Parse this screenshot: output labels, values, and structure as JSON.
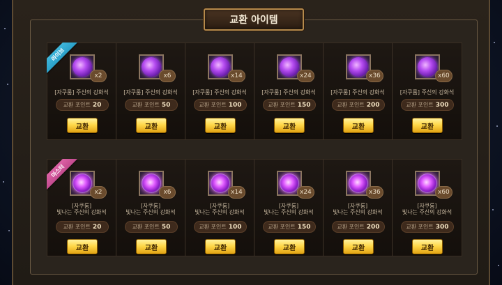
{
  "title": "교환 아이템",
  "colors": {
    "ribbon_live": "#2aa0c8",
    "ribbon_master": "#c24a8e",
    "button_gold": "#ffd84a"
  },
  "groups": [
    {
      "ribbon": "라이브",
      "items": [
        {
          "icon": "purple-gem-icon",
          "qty": "x2",
          "name_line1": "[자쿠룸] 주신의 강화석",
          "name_line2": "",
          "points_label": "교환 포인트",
          "points": "20",
          "button": "교환"
        },
        {
          "icon": "purple-gem-icon",
          "qty": "x6",
          "name_line1": "[자쿠룸] 주신의 강화석",
          "name_line2": "",
          "points_label": "교환 포인트",
          "points": "50",
          "button": "교환"
        },
        {
          "icon": "purple-gem-icon",
          "qty": "x14",
          "name_line1": "[자쿠룸] 주신의 강화석",
          "name_line2": "",
          "points_label": "교환 포인트",
          "points": "100",
          "button": "교환"
        },
        {
          "icon": "purple-gem-icon",
          "qty": "x24",
          "name_line1": "[자쿠룸] 주신의 강화석",
          "name_line2": "",
          "points_label": "교환 포인트",
          "points": "150",
          "button": "교환"
        },
        {
          "icon": "purple-gem-icon",
          "qty": "x36",
          "name_line1": "[자쿠룸] 주신의 강화석",
          "name_line2": "",
          "points_label": "교환 포인트",
          "points": "200",
          "button": "교환"
        },
        {
          "icon": "purple-gem-icon",
          "qty": "x60",
          "name_line1": "[자쿠룸] 주신의 강화석",
          "name_line2": "",
          "points_label": "교환 포인트",
          "points": "300",
          "button": "교환"
        }
      ]
    },
    {
      "ribbon": "마스터",
      "items": [
        {
          "icon": "shining-gem-icon",
          "qty": "x2",
          "name_line1": "[자쿠룸]",
          "name_line2": "빛나는 주신의 강화석",
          "points_label": "교환 포인트",
          "points": "20",
          "button": "교환"
        },
        {
          "icon": "shining-gem-icon",
          "qty": "x6",
          "name_line1": "[자쿠룸]",
          "name_line2": "빛나는 주신의 강화석",
          "points_label": "교환 포인트",
          "points": "50",
          "button": "교환"
        },
        {
          "icon": "shining-gem-icon",
          "qty": "x14",
          "name_line1": "[자쿠룸]",
          "name_line2": "빛나는 주신의 강화석",
          "points_label": "교환 포인트",
          "points": "100",
          "button": "교환"
        },
        {
          "icon": "shining-gem-icon",
          "qty": "x24",
          "name_line1": "[자쿠룸]",
          "name_line2": "빛나는 주신의 강화석",
          "points_label": "교환 포인트",
          "points": "150",
          "button": "교환"
        },
        {
          "icon": "shining-gem-icon",
          "qty": "x36",
          "name_line1": "[자쿠룸]",
          "name_line2": "빛나는 주신의 강화석",
          "points_label": "교환 포인트",
          "points": "200",
          "button": "교환"
        },
        {
          "icon": "shining-gem-icon",
          "qty": "x60",
          "name_line1": "[자쿠룸]",
          "name_line2": "빛나는 주신의 강화석",
          "points_label": "교환 포인트",
          "points": "300",
          "button": "교환"
        }
      ]
    }
  ]
}
